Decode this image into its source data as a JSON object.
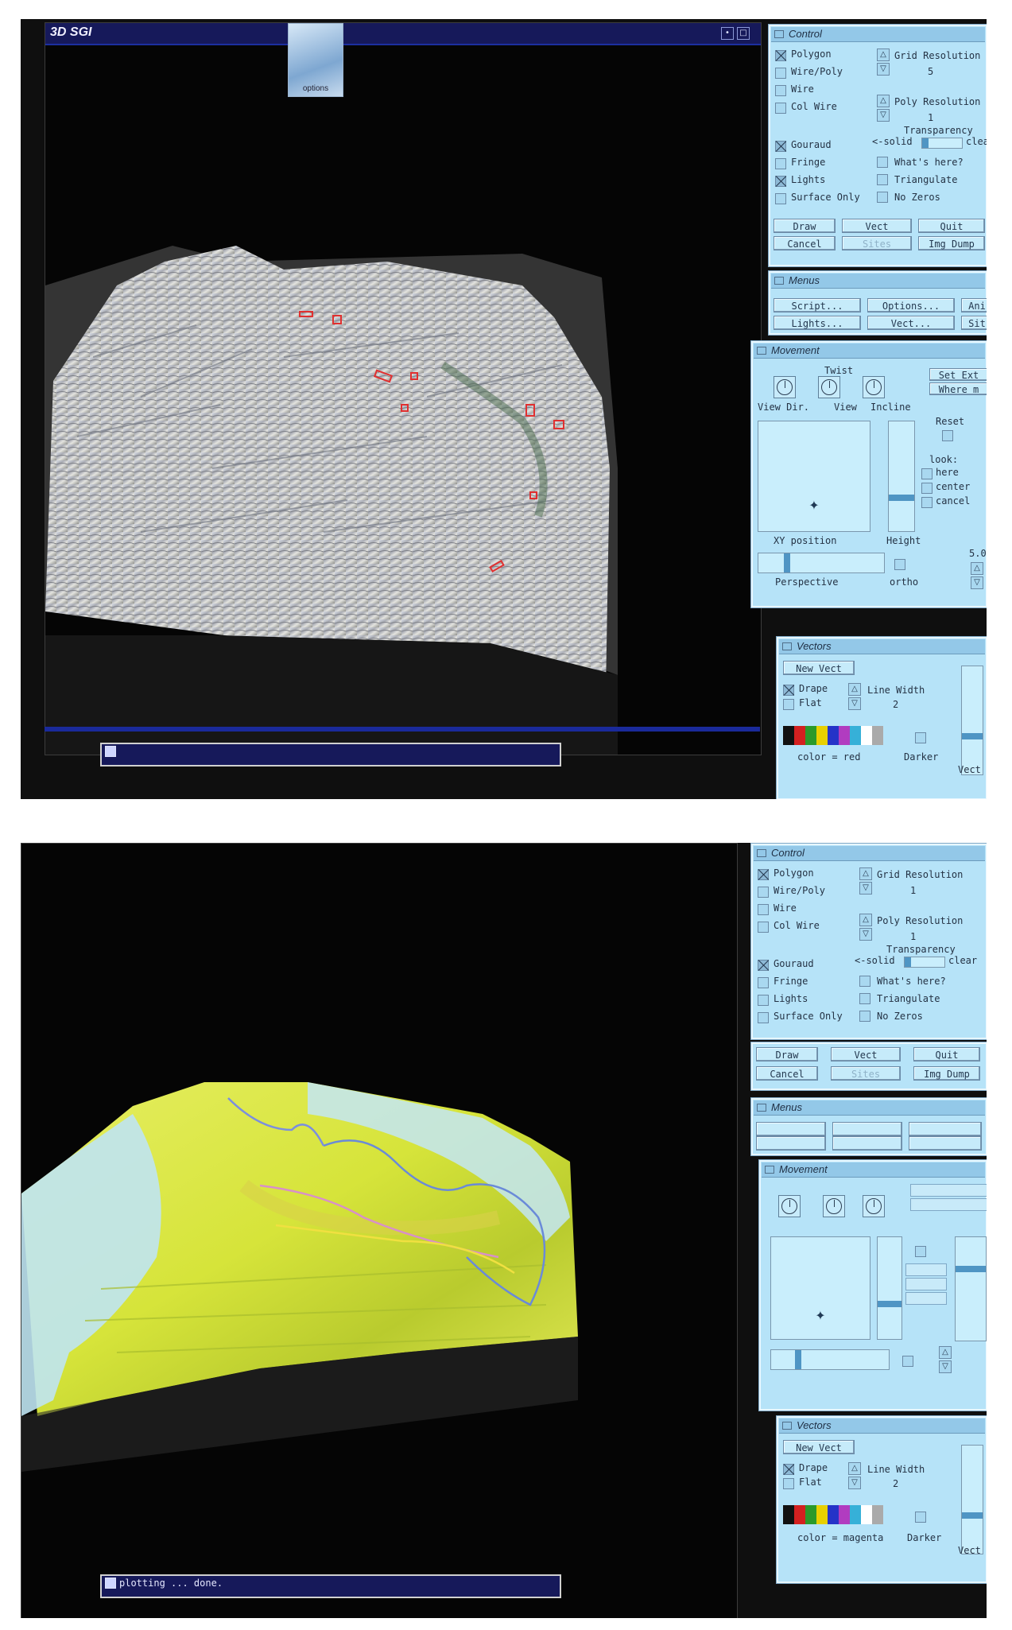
{
  "screen1": {
    "window_title": "3D SGI",
    "options_button": "options",
    "command_line": "",
    "control": {
      "title": "Control",
      "modes": [
        "Polygon",
        "Wire/Poly",
        "Wire",
        "Col Wire"
      ],
      "modes_checked": [
        true,
        false,
        false,
        false
      ],
      "grid_resolution_label": "Grid Resolution",
      "grid_resolution_value": "5",
      "poly_resolution_label": "Poly Resolution",
      "poly_resolution_value": "1",
      "transparency_label": "Transparency",
      "transparency_left": "<-solid",
      "transparency_right": "clear",
      "shading": [
        "Gouraud",
        "Fringe",
        "Lights",
        "Surface Only"
      ],
      "shading_checked": [
        true,
        false,
        true,
        false
      ],
      "tools": [
        "What's here?",
        "Triangulate",
        "No Zeros"
      ],
      "buttons": [
        "Draw",
        "Vect",
        "Quit",
        "Cancel",
        "Sites",
        "Img Dump"
      ]
    },
    "menus": {
      "title": "Menus",
      "items": [
        "Script...",
        "Options...",
        "Ani",
        "Lights...",
        "Vect...",
        "Sit"
      ]
    },
    "movement": {
      "title": "Movement",
      "twist": "Twist",
      "dials": [
        "View Dir.",
        "View",
        "Incline"
      ],
      "set_label": "Set Ext",
      "where_label": "Where m",
      "reset": "Reset",
      "look_label": "look:",
      "look_items": [
        "here",
        "center",
        "cancel"
      ],
      "xy_label": "XY position",
      "height_label": "Height",
      "perspective_label": "Perspective",
      "ortho_label": "ortho",
      "scale_value": "5.0"
    },
    "vectors": {
      "title": "Vectors",
      "new_vect": "New Vect",
      "drape": "Drape",
      "flat": "Flat",
      "drape_checked": true,
      "line_width_label": "Line Width",
      "line_width_value": "2",
      "palette": [
        "#111111",
        "#d32020",
        "#2a9a2a",
        "#e8d000",
        "#2533c8",
        "#b13cc0",
        "#36b0d8",
        "#ffffff",
        "#aaaaaa"
      ],
      "color_label": "color = red",
      "darker": "Darker",
      "side_label": "Vect"
    }
  },
  "screen2": {
    "command_line": "plotting ... done.",
    "control": {
      "title": "Control",
      "modes": [
        "Polygon",
        "Wire/Poly",
        "Wire",
        "Col Wire"
      ],
      "modes_checked": [
        true,
        false,
        false,
        false
      ],
      "grid_resolution_label": "Grid Resolution",
      "grid_resolution_value": "1",
      "poly_resolution_label": "Poly Resolution",
      "poly_resolution_value": "1",
      "transparency_label": "Transparency",
      "transparency_left": "<-solid",
      "transparency_right": "clear",
      "shading": [
        "Gouraud",
        "Fringe",
        "Lights",
        "Surface Only"
      ],
      "shading_checked": [
        true,
        false,
        false,
        false
      ],
      "tools": [
        "What's here?",
        "Triangulate",
        "No Zeros"
      ],
      "buttons": [
        "Draw",
        "Vect",
        "Quit",
        "Cancel",
        "Sites",
        "Img Dump"
      ]
    },
    "menus": {
      "title": "Menus"
    },
    "movement": {
      "title": "Movement"
    },
    "vectors": {
      "title": "Vectors",
      "new_vect": "New Vect",
      "drape": "Drape",
      "flat": "Flat",
      "drape_checked": true,
      "line_width_label": "Line Width",
      "line_width_value": "2",
      "palette": [
        "#111111",
        "#d32020",
        "#2a9a2a",
        "#e8d000",
        "#2533c8",
        "#b13cc0",
        "#36b0d8",
        "#ffffff",
        "#aaaaaa"
      ],
      "color_label": "color = magenta",
      "darker": "Darker",
      "side_label": "Vect"
    }
  }
}
